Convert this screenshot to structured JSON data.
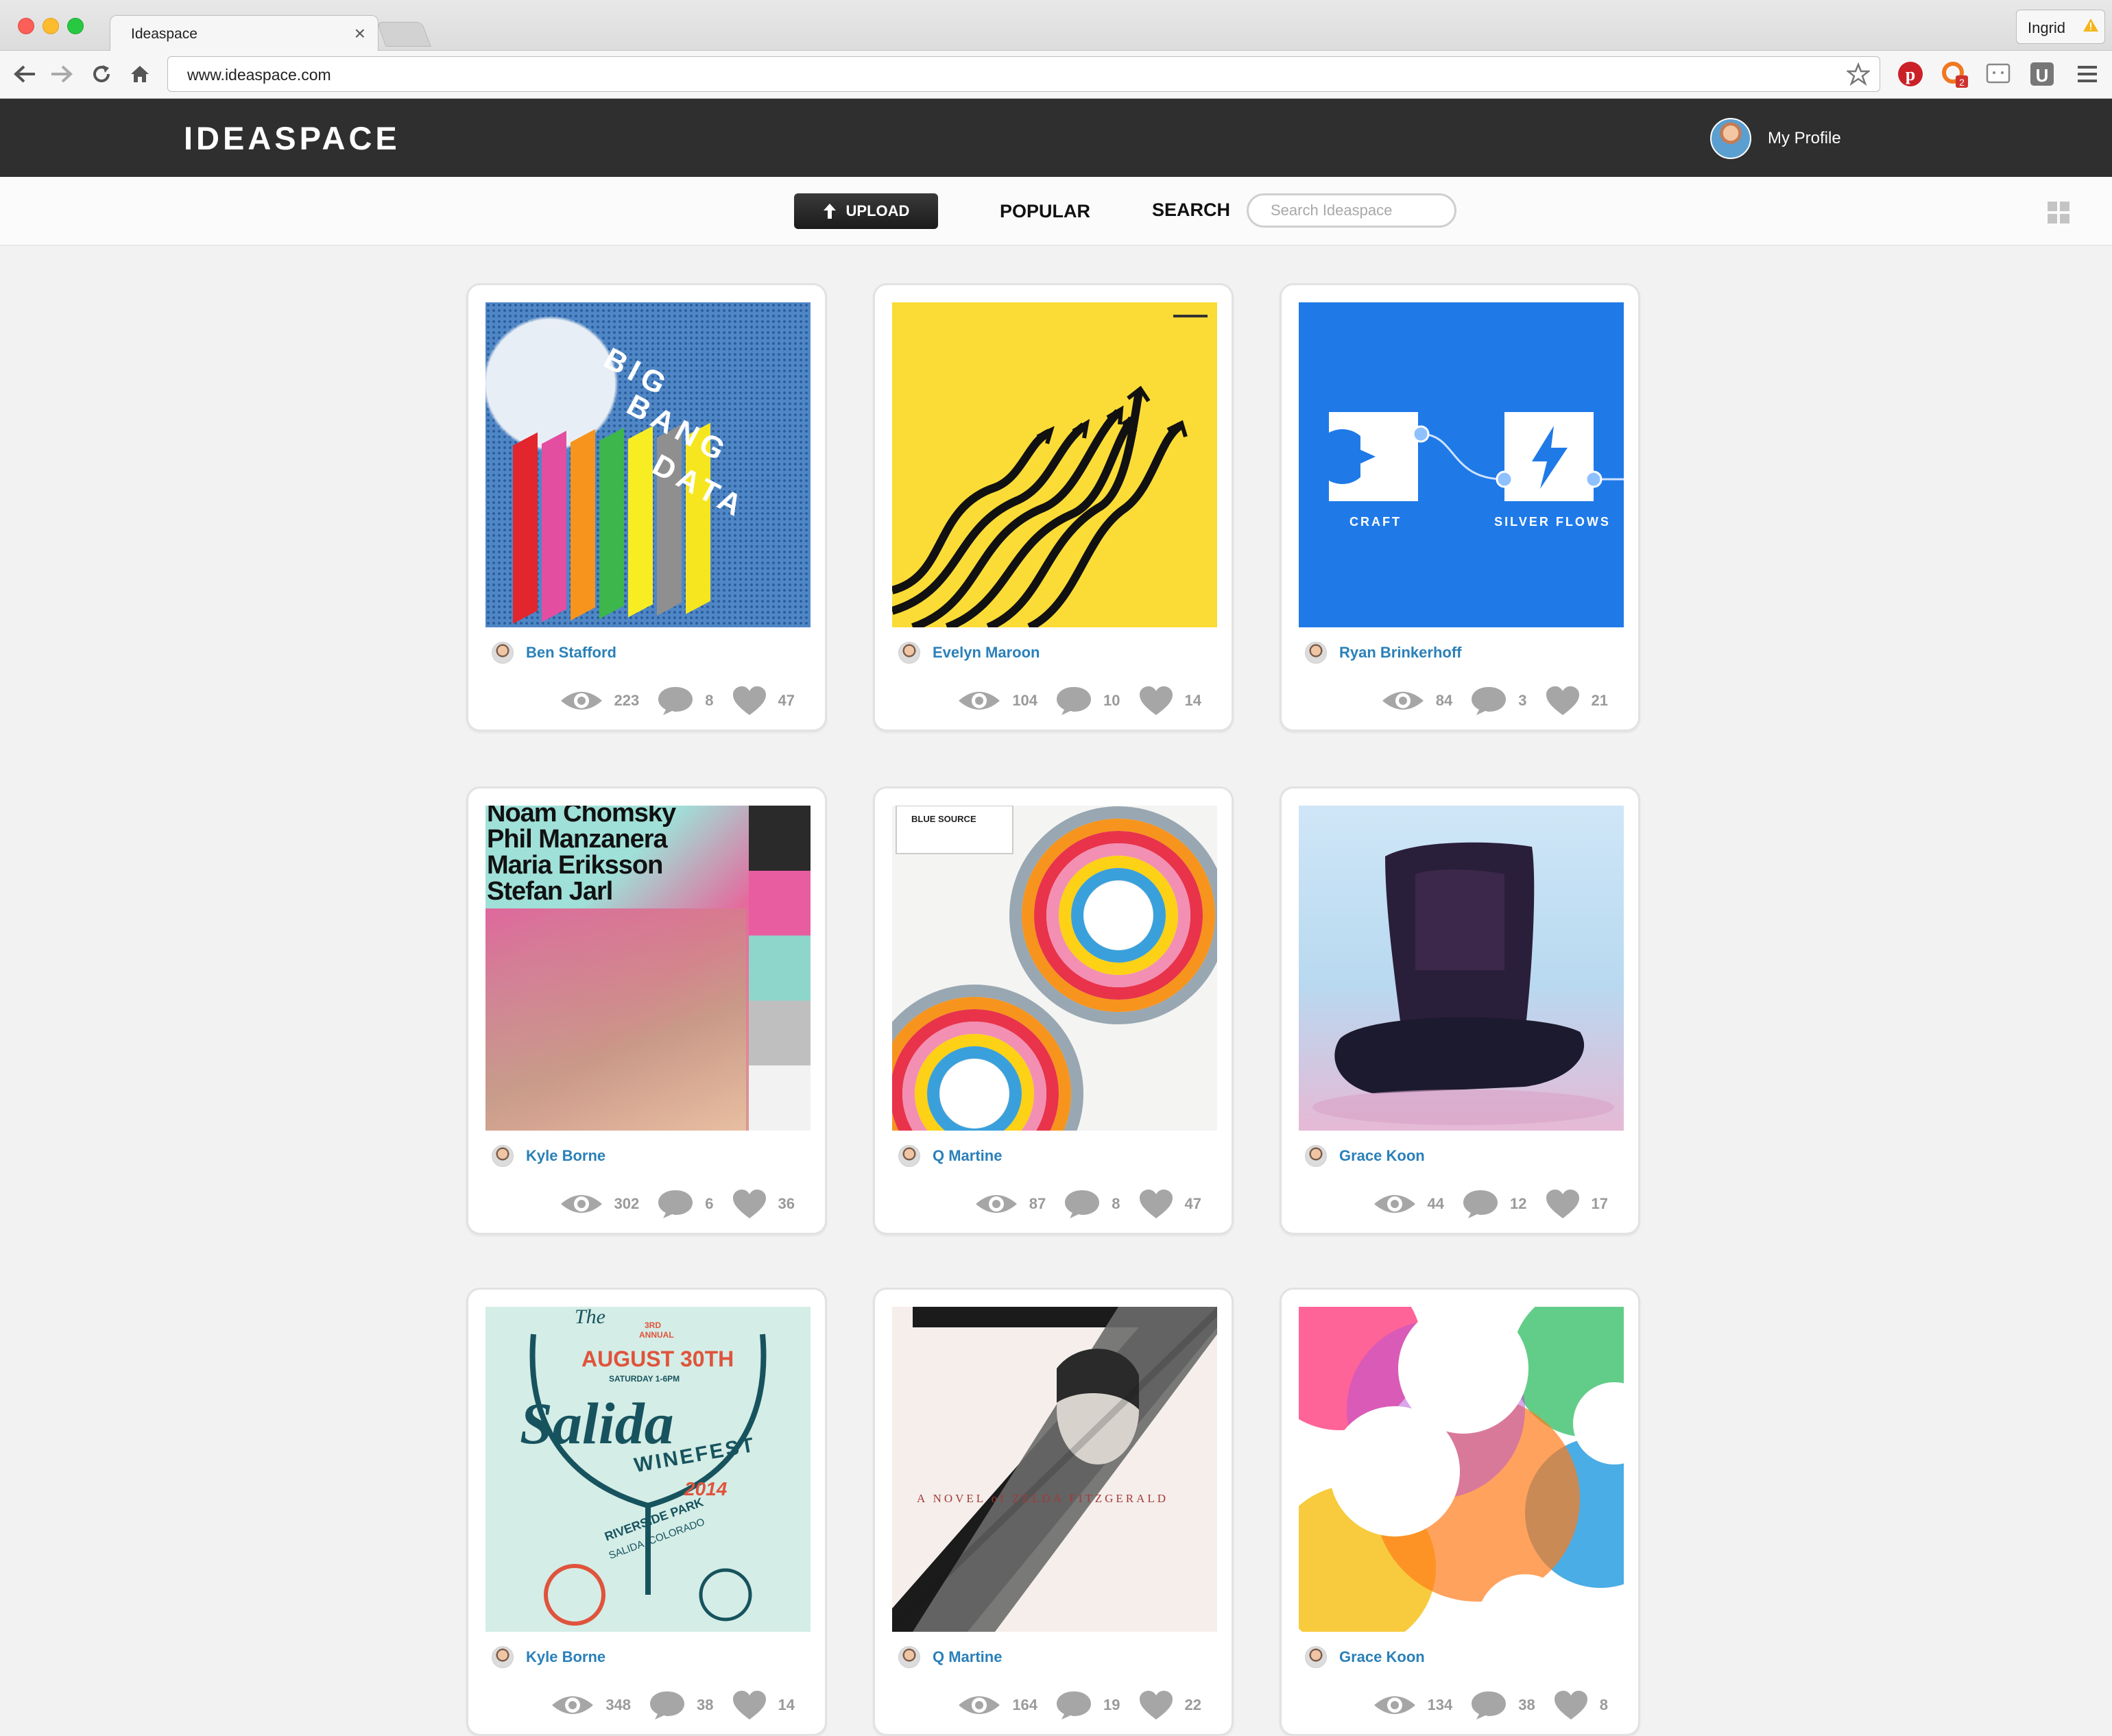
{
  "browser": {
    "tab_title": "Ideaspace",
    "url": "www.ideaspace.com",
    "user_name": "Ingrid",
    "ext_badge": "2"
  },
  "header": {
    "logo": "IDEASPACE",
    "profile_label": "My Profile"
  },
  "subnav": {
    "upload_label": "UPLOAD",
    "popular_label": "POPULAR",
    "search_label": "SEARCH",
    "search_placeholder": "Search Ideaspace"
  },
  "cards": [
    {
      "author": "Ben Stafford",
      "views": "223",
      "comments": "8",
      "likes": "47",
      "art_text": [
        "BIG",
        "BANG",
        "DATA"
      ]
    },
    {
      "author": "Evelyn Maroon",
      "views": "104",
      "comments": "10",
      "likes": "14"
    },
    {
      "author": "Ryan Brinkerhoff",
      "views": "84",
      "comments": "3",
      "likes": "21",
      "art_text": [
        "CRAFT",
        "SILVER FLOWS"
      ]
    },
    {
      "author": "Kyle Borne",
      "views": "302",
      "comments": "6",
      "likes": "36",
      "art_text": [
        "Noam Chomsky",
        "Phil Manzanera",
        "Maria Eriksson",
        "Stefan Jarl"
      ]
    },
    {
      "author": "Q Martine",
      "views": "87",
      "comments": "8",
      "likes": "47",
      "art_text": [
        "BLUE SOURCE"
      ]
    },
    {
      "author": "Grace Koon",
      "views": "44",
      "comments": "12",
      "likes": "17"
    },
    {
      "author": "Kyle Borne",
      "views": "348",
      "comments": "38",
      "likes": "14",
      "art_text": [
        "The",
        "3RD ANNUAL",
        "AUGUST 30TH",
        "SATURDAY 1-6PM",
        "Salida",
        "WINEFEST",
        "2014",
        "RIVERSIDE PARK",
        "SALIDA, COLORADO"
      ]
    },
    {
      "author": "Q Martine",
      "views": "164",
      "comments": "19",
      "likes": "22",
      "art_text": [
        "A NOVEL of ZELDA FITZGERALD"
      ]
    },
    {
      "author": "Grace Koon",
      "views": "134",
      "comments": "38",
      "likes": "8"
    }
  ],
  "colors": {
    "header_bg": "#2f2f2f",
    "author_link": "#2a80b9",
    "stat_gray": "#9a9a9a"
  }
}
